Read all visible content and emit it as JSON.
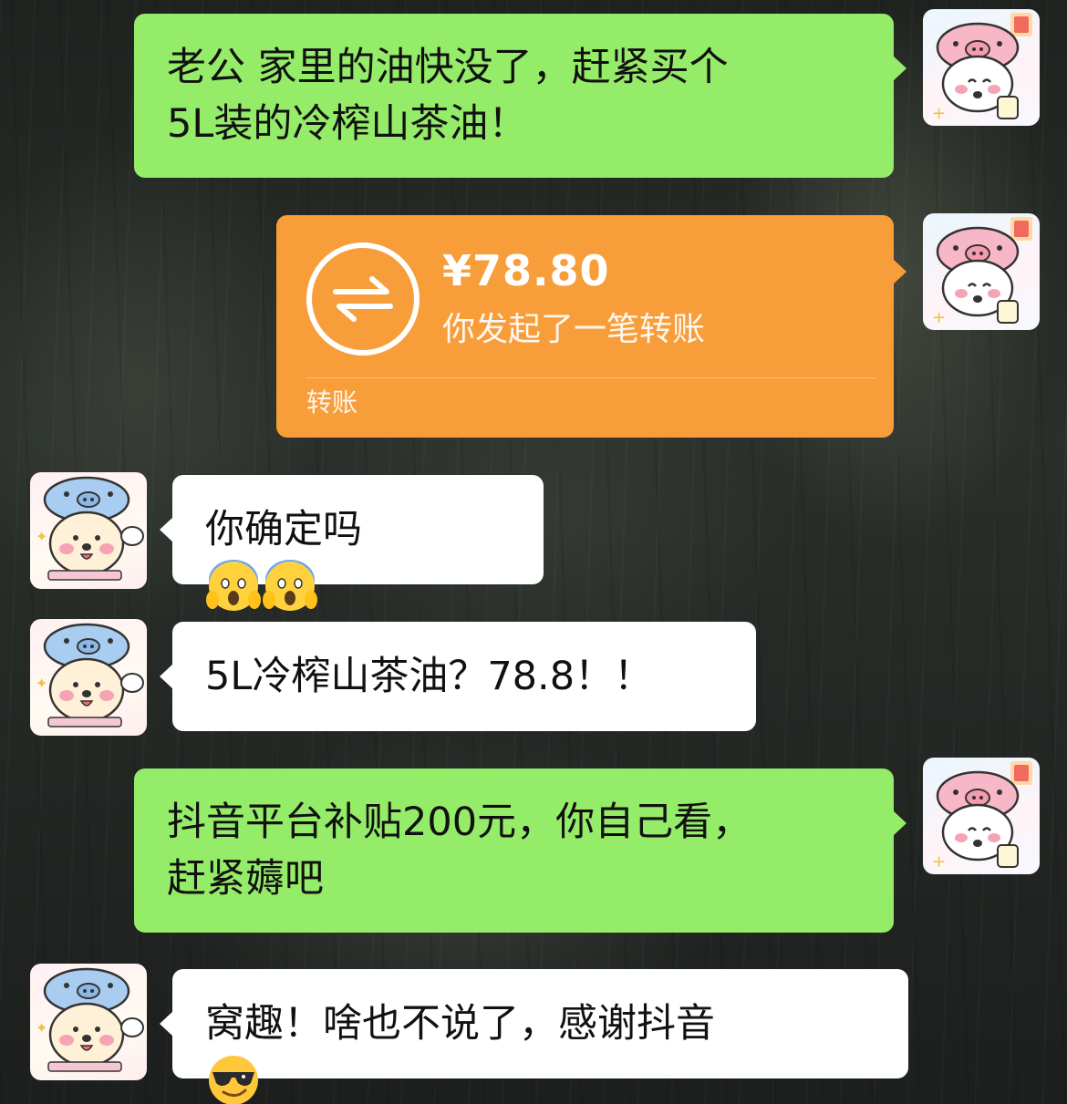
{
  "messages": [
    {
      "side": "right",
      "text": "老公 家里的油快没了，赶紧买个\n5L装的冷榨山茶油！"
    },
    {
      "side": "left",
      "text": "你确定吗"
    },
    {
      "side": "left",
      "text": "5L冷榨山茶油？78.8！！"
    },
    {
      "side": "right",
      "text": "抖音平台补贴200元，你自己看，\n赶紧薅吧"
    },
    {
      "side": "left",
      "text": "窝趣！啥也不说了，感谢抖音"
    }
  ],
  "transfer": {
    "amount": "¥78.80",
    "description": "你发起了一笔转账",
    "label": "转账",
    "color": "#f79e3b"
  },
  "emojis": {
    "msg2": [
      "scream-emoji",
      "scream-emoji"
    ],
    "msg5": [
      "sunglasses-emoji"
    ]
  },
  "colors": {
    "sent_bubble": "#95ec69",
    "received_bubble": "#ffffff"
  }
}
